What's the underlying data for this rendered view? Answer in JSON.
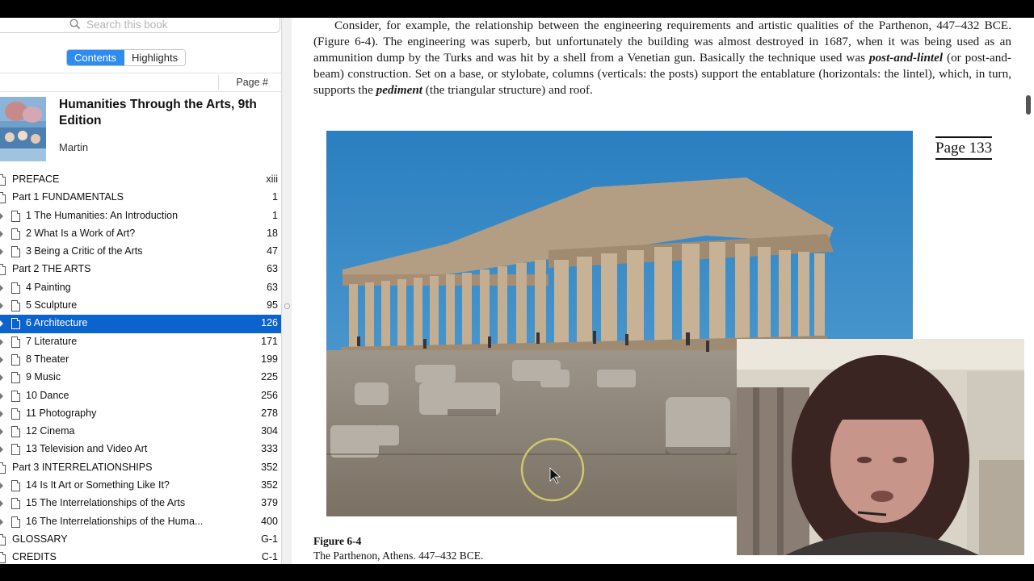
{
  "search": {
    "placeholder": "Search this book"
  },
  "tabs": {
    "contents": "Contents",
    "highlights": "Highlights"
  },
  "column_header": {
    "page": "Page #"
  },
  "book": {
    "title": "Humanities Through the Arts,  9th Edition",
    "author": "Martin"
  },
  "toc": [
    {
      "label": "PREFACE",
      "page": "xiii",
      "level": 0,
      "expand": false,
      "doc": false,
      "selected": false
    },
    {
      "label": "Part 1 FUNDAMENTALS",
      "page": "1",
      "level": 0,
      "expand": false,
      "doc": false,
      "selected": false
    },
    {
      "label": "1 The Humanities: An Introduction",
      "page": "1",
      "level": 1,
      "expand": true,
      "doc": true,
      "selected": false
    },
    {
      "label": "2 What Is a Work of Art?",
      "page": "18",
      "level": 1,
      "expand": true,
      "doc": true,
      "selected": false
    },
    {
      "label": "3 Being a Critic of the Arts",
      "page": "47",
      "level": 1,
      "expand": true,
      "doc": true,
      "selected": false
    },
    {
      "label": "Part 2 THE ARTS",
      "page": "63",
      "level": 0,
      "expand": false,
      "doc": false,
      "selected": false
    },
    {
      "label": "4 Painting",
      "page": "63",
      "level": 1,
      "expand": true,
      "doc": true,
      "selected": false
    },
    {
      "label": "5 Sculpture",
      "page": "95",
      "level": 1,
      "expand": true,
      "doc": true,
      "selected": false
    },
    {
      "label": "6 Architecture",
      "page": "126",
      "level": 1,
      "expand": true,
      "doc": true,
      "selected": true
    },
    {
      "label": "7 Literature",
      "page": "171",
      "level": 1,
      "expand": true,
      "doc": true,
      "selected": false
    },
    {
      "label": "8 Theater",
      "page": "199",
      "level": 1,
      "expand": true,
      "doc": true,
      "selected": false
    },
    {
      "label": "9 Music",
      "page": "225",
      "level": 1,
      "expand": true,
      "doc": true,
      "selected": false
    },
    {
      "label": "10 Dance",
      "page": "256",
      "level": 1,
      "expand": true,
      "doc": true,
      "selected": false
    },
    {
      "label": "11 Photography",
      "page": "278",
      "level": 1,
      "expand": true,
      "doc": true,
      "selected": false
    },
    {
      "label": "12 Cinema",
      "page": "304",
      "level": 1,
      "expand": true,
      "doc": true,
      "selected": false
    },
    {
      "label": "13 Television and Video Art",
      "page": "333",
      "level": 1,
      "expand": true,
      "doc": true,
      "selected": false
    },
    {
      "label": "Part 3 INTERRELATIONSHIPS",
      "page": "352",
      "level": 0,
      "expand": false,
      "doc": false,
      "selected": false
    },
    {
      "label": "14 Is It Art or Something Like It?",
      "page": "352",
      "level": 1,
      "expand": true,
      "doc": true,
      "selected": false
    },
    {
      "label": "15 The Interrelationships of the Arts",
      "page": "379",
      "level": 1,
      "expand": true,
      "doc": true,
      "selected": false
    },
    {
      "label": "16 The Interrelationships of the Huma...",
      "page": "400",
      "level": 1,
      "expand": true,
      "doc": true,
      "selected": false
    },
    {
      "label": "GLOSSARY",
      "page": "G-1",
      "level": 0,
      "expand": false,
      "doc": false,
      "selected": false
    },
    {
      "label": "CREDITS",
      "page": "C-1",
      "level": 0,
      "expand": false,
      "doc": false,
      "selected": false
    }
  ],
  "content": {
    "p1": "Consider, for example, the relationship between the engineering requirements and artistic qualities of the Parthenon, 447–432 BCE. (Figure 6-4). The engineering was superb, but unfortunately the building was almost destroyed in 1687, when it was being used as an ammunition dump by the Turks and was hit by a shell from a Venetian gun. Basically the technique used was ",
    "term1": "post-and-lintel",
    "p2": " (or post-and-beam) construction. Set on a base, or stylobate, columns (verticals: the posts) support the entablature (horizontals: the lintel), which, in turn, supports the ",
    "term2": "pediment",
    "p3": " (the triangular structure) and roof.",
    "page_label": "Page 133",
    "figure_label": "Figure 6-4",
    "figure_caption": "The Parthenon, Athens. 447–432 BCE."
  },
  "colors": {
    "selection": "#0b63ce",
    "segment_active": "#2d8cf0",
    "sky": "#2f86c6"
  }
}
